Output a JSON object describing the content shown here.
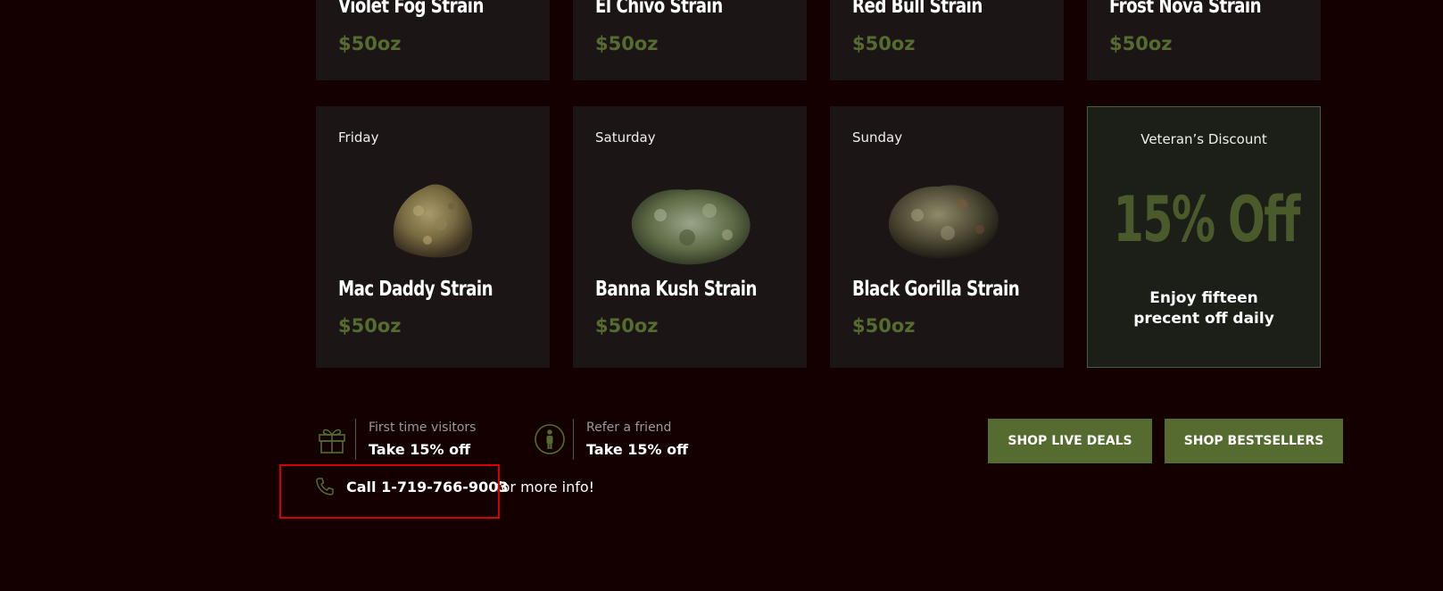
{
  "top_row": [
    {
      "name": "Violet Fog Strain",
      "price": "$50oz"
    },
    {
      "name": "El Chivo Strain",
      "price": "$50oz"
    },
    {
      "name": "Red Bull Strain",
      "price": "$50oz"
    },
    {
      "name": "Frost Nova Strain",
      "price": "$50oz"
    }
  ],
  "deals": [
    {
      "day": "Friday",
      "name": "Mac Daddy Strain",
      "price": "$50oz"
    },
    {
      "day": "Saturday",
      "name": "Banna Kush Strain",
      "price": "$50oz"
    },
    {
      "day": "Sunday",
      "name": "Black Gorilla Strain",
      "price": "$50oz"
    }
  ],
  "veteran": {
    "title": "Veteran’s Discount",
    "big": "15% Off",
    "desc": "Enjoy fifteen precent off daily"
  },
  "promos": [
    {
      "label": "First time visitors",
      "value": "Take 15% off",
      "icon": "gift-icon"
    },
    {
      "label": "Refer a friend",
      "value": "Take 15% off",
      "icon": "person-icon"
    }
  ],
  "buttons": {
    "live_deals": "SHOP LIVE DEALS",
    "bestsellers": "SHOP BESTSELLERS"
  },
  "call": {
    "number": "Call 1-719-766-9003",
    "suffix": "for more info!",
    "icon": "phone-icon"
  },
  "colors": {
    "background": "#150000",
    "card": "#1c1515",
    "accent_green": "#556b2f",
    "highlight": "#d40000"
  }
}
